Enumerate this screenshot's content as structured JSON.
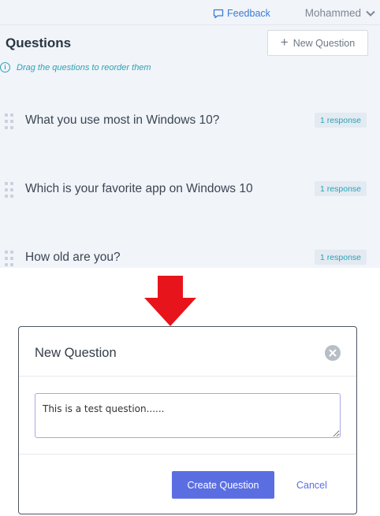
{
  "topbar": {
    "feedback_label": "Feedback",
    "feedback_icon": "comment-icon",
    "user_name": "Mohammed",
    "user_menu_icon": "chevron-down-icon"
  },
  "questions_panel": {
    "title": "Questions",
    "new_question_label": "New Question",
    "new_question_icon": "plus-icon",
    "hint": "Drag the questions to reorder them",
    "hint_icon": "info-icon",
    "items": [
      {
        "text": "What you use most in Windows 10?",
        "responses": "1 response"
      },
      {
        "text": "Which is your favorite app on Windows 10",
        "responses": "1 response"
      },
      {
        "text": "How old are you?",
        "responses": "1 response"
      }
    ]
  },
  "arrow": {
    "icon": "down-arrow-icon",
    "color": "#e8141b"
  },
  "modal": {
    "title": "New Question",
    "close_icon": "close-icon",
    "input_value": "This is a test question......",
    "create_label": "Create Question",
    "cancel_label": "Cancel"
  },
  "colors": {
    "panel_bg": "#f1f4f9",
    "accent": "#5b6ee1",
    "teal": "#2aa3b6",
    "arrow": "#e8141b"
  }
}
